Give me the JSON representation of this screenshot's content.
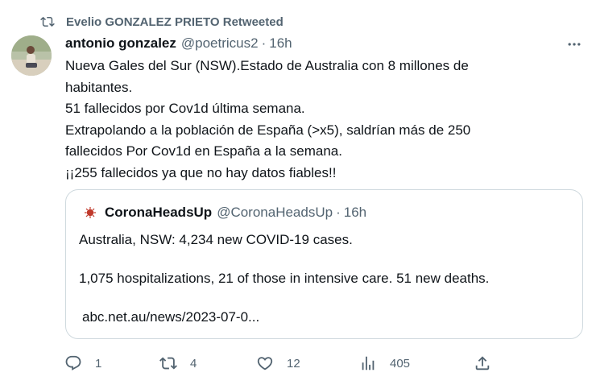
{
  "retweet": {
    "text": "Evelio GONZALEZ PRIETO Retweeted"
  },
  "tweet": {
    "display_name": "antonio gonzalez",
    "handle": "@poetricus2",
    "separator": "·",
    "time": "16h",
    "lines": [
      "Nueva Gales del Sur (NSW).Estado de Australia con 8 millones de",
      "habitantes.",
      "51 fallecidos por Cov1d última semana.",
      "Extrapolando a la población de España (>x5), saldrían más de 250",
      "fallecidos Por Cov1d en España a la semana.",
      "¡¡255 fallecidos ya que no hay datos fiables!!"
    ]
  },
  "quote": {
    "display_name": "CoronaHeadsUp",
    "handle": "@CoronaHeadsUp",
    "separator": "·",
    "time": "16h",
    "line1": "Australia, NSW: 4,234 new COVID-19 cases.",
    "line2": "1,075 hospitalizations, 21 of those in intensive care.  51 new deaths.",
    "link": "abc.net.au/news/2023-07-0..."
  },
  "actions": {
    "replies": "1",
    "retweets": "4",
    "likes": "12",
    "views": "405"
  },
  "colors": {
    "text": "#0f1419",
    "secondary": "#536471",
    "border": "#cfd9de",
    "quote_avatar": "#c0392b"
  }
}
